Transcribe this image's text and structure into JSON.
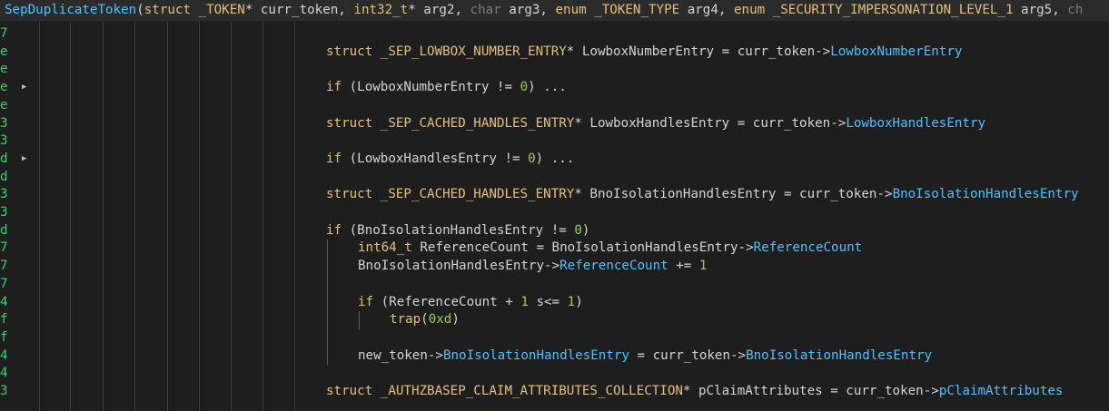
{
  "header": [
    {
      "t": "SepDuplicateToken",
      "c": "fn"
    },
    {
      "t": "(",
      "c": "pl"
    },
    {
      "t": "struct _TOKEN",
      "c": "kw"
    },
    {
      "t": "* curr_token, ",
      "c": "pl"
    },
    {
      "t": "int32_t",
      "c": "kw"
    },
    {
      "t": "* arg2, ",
      "c": "pl"
    },
    {
      "t": "char",
      "c": "mut"
    },
    {
      "t": " arg3, ",
      "c": "pl"
    },
    {
      "t": "enum _TOKEN_TYPE",
      "c": "kw"
    },
    {
      "t": " arg4, ",
      "c": "pl"
    },
    {
      "t": "enum _SECURITY_IMPERSONATION_LEVEL_1",
      "c": "kw"
    },
    {
      "t": " arg5, ",
      "c": "pl"
    },
    {
      "t": "ch",
      "c": "mut"
    }
  ],
  "gutter": [
    "7",
    "e",
    "e",
    "e",
    "e",
    "3",
    "3",
    "d",
    "d",
    "3",
    "3",
    "d",
    "7",
    "7",
    "7",
    "4",
    "f",
    "f",
    "4",
    "4",
    "3"
  ],
  "fold_rows": [
    3,
    7
  ],
  "lines": [
    {
      "row": 1,
      "indent": 0,
      "tokens": [
        {
          "t": "struct _SEP_LOWBOX_NUMBER_ENTRY",
          "c": "ty"
        },
        {
          "t": "* LowboxNumberEntry = curr_token->",
          "c": "pl"
        },
        {
          "t": "LowboxNumberEntry",
          "c": "fld"
        }
      ]
    },
    {
      "row": 3,
      "indent": 0,
      "tokens": [
        {
          "t": "if",
          "c": "kw"
        },
        {
          "t": " (LowboxNumberEntry != ",
          "c": "pl"
        },
        {
          "t": "0",
          "c": "num"
        },
        {
          "t": ") ...",
          "c": "pl"
        }
      ]
    },
    {
      "row": 5,
      "indent": 0,
      "tokens": [
        {
          "t": "struct _SEP_CACHED_HANDLES_ENTRY",
          "c": "ty"
        },
        {
          "t": "* LowboxHandlesEntry = curr_token->",
          "c": "pl"
        },
        {
          "t": "LowboxHandlesEntry",
          "c": "fld"
        }
      ]
    },
    {
      "row": 7,
      "indent": 0,
      "tokens": [
        {
          "t": "if",
          "c": "kw"
        },
        {
          "t": " (LowboxHandlesEntry != ",
          "c": "pl"
        },
        {
          "t": "0",
          "c": "num"
        },
        {
          "t": ") ...",
          "c": "pl"
        }
      ]
    },
    {
      "row": 9,
      "indent": 0,
      "tokens": [
        {
          "t": "struct _SEP_CACHED_HANDLES_ENTRY",
          "c": "ty"
        },
        {
          "t": "* BnoIsolationHandlesEntry = curr_token->",
          "c": "pl"
        },
        {
          "t": "BnoIsolationHandlesEntry",
          "c": "fld"
        }
      ]
    },
    {
      "row": 11,
      "indent": 0,
      "tokens": [
        {
          "t": "if",
          "c": "kw"
        },
        {
          "t": " (BnoIsolationHandlesEntry != ",
          "c": "pl"
        },
        {
          "t": "0",
          "c": "num"
        },
        {
          "t": ")",
          "c": "pl"
        }
      ]
    },
    {
      "row": 12,
      "indent": 1,
      "tokens": [
        {
          "t": "int64_t",
          "c": "ty"
        },
        {
          "t": " ReferenceCount = BnoIsolationHandlesEntry->",
          "c": "pl"
        },
        {
          "t": "ReferenceCount",
          "c": "fld"
        }
      ]
    },
    {
      "row": 13,
      "indent": 1,
      "tokens": [
        {
          "t": "BnoIsolationHandlesEntry->",
          "c": "pl"
        },
        {
          "t": "ReferenceCount",
          "c": "fld"
        },
        {
          "t": " += ",
          "c": "pl"
        },
        {
          "t": "1",
          "c": "num"
        }
      ]
    },
    {
      "row": 15,
      "indent": 1,
      "tokens": [
        {
          "t": "if",
          "c": "kw"
        },
        {
          "t": " (ReferenceCount + ",
          "c": "pl"
        },
        {
          "t": "1",
          "c": "num"
        },
        {
          "t": " s<= ",
          "c": "pl"
        },
        {
          "t": "1",
          "c": "num"
        },
        {
          "t": ")",
          "c": "pl"
        }
      ]
    },
    {
      "row": 16,
      "indent": 2,
      "tokens": [
        {
          "t": "trap",
          "c": "kw"
        },
        {
          "t": "(",
          "c": "pl"
        },
        {
          "t": "0xd",
          "c": "num"
        },
        {
          "t": ")",
          "c": "pl"
        }
      ]
    },
    {
      "row": 18,
      "indent": 1,
      "tokens": [
        {
          "t": "new_token->",
          "c": "pl"
        },
        {
          "t": "BnoIsolationHandlesEntry",
          "c": "fld"
        },
        {
          "t": " = curr_token->",
          "c": "pl"
        },
        {
          "t": "BnoIsolationHandlesEntry",
          "c": "fld"
        }
      ]
    },
    {
      "row": 20,
      "indent": 0,
      "tokens": [
        {
          "t": "struct _AUTHZBASEP_CLAIM_ATTRIBUTES_COLLECTION",
          "c": "ty"
        },
        {
          "t": "* pClaimAttributes = curr_token->",
          "c": "pl"
        },
        {
          "t": "pClaimAttributes",
          "c": "fld"
        }
      ]
    }
  ]
}
